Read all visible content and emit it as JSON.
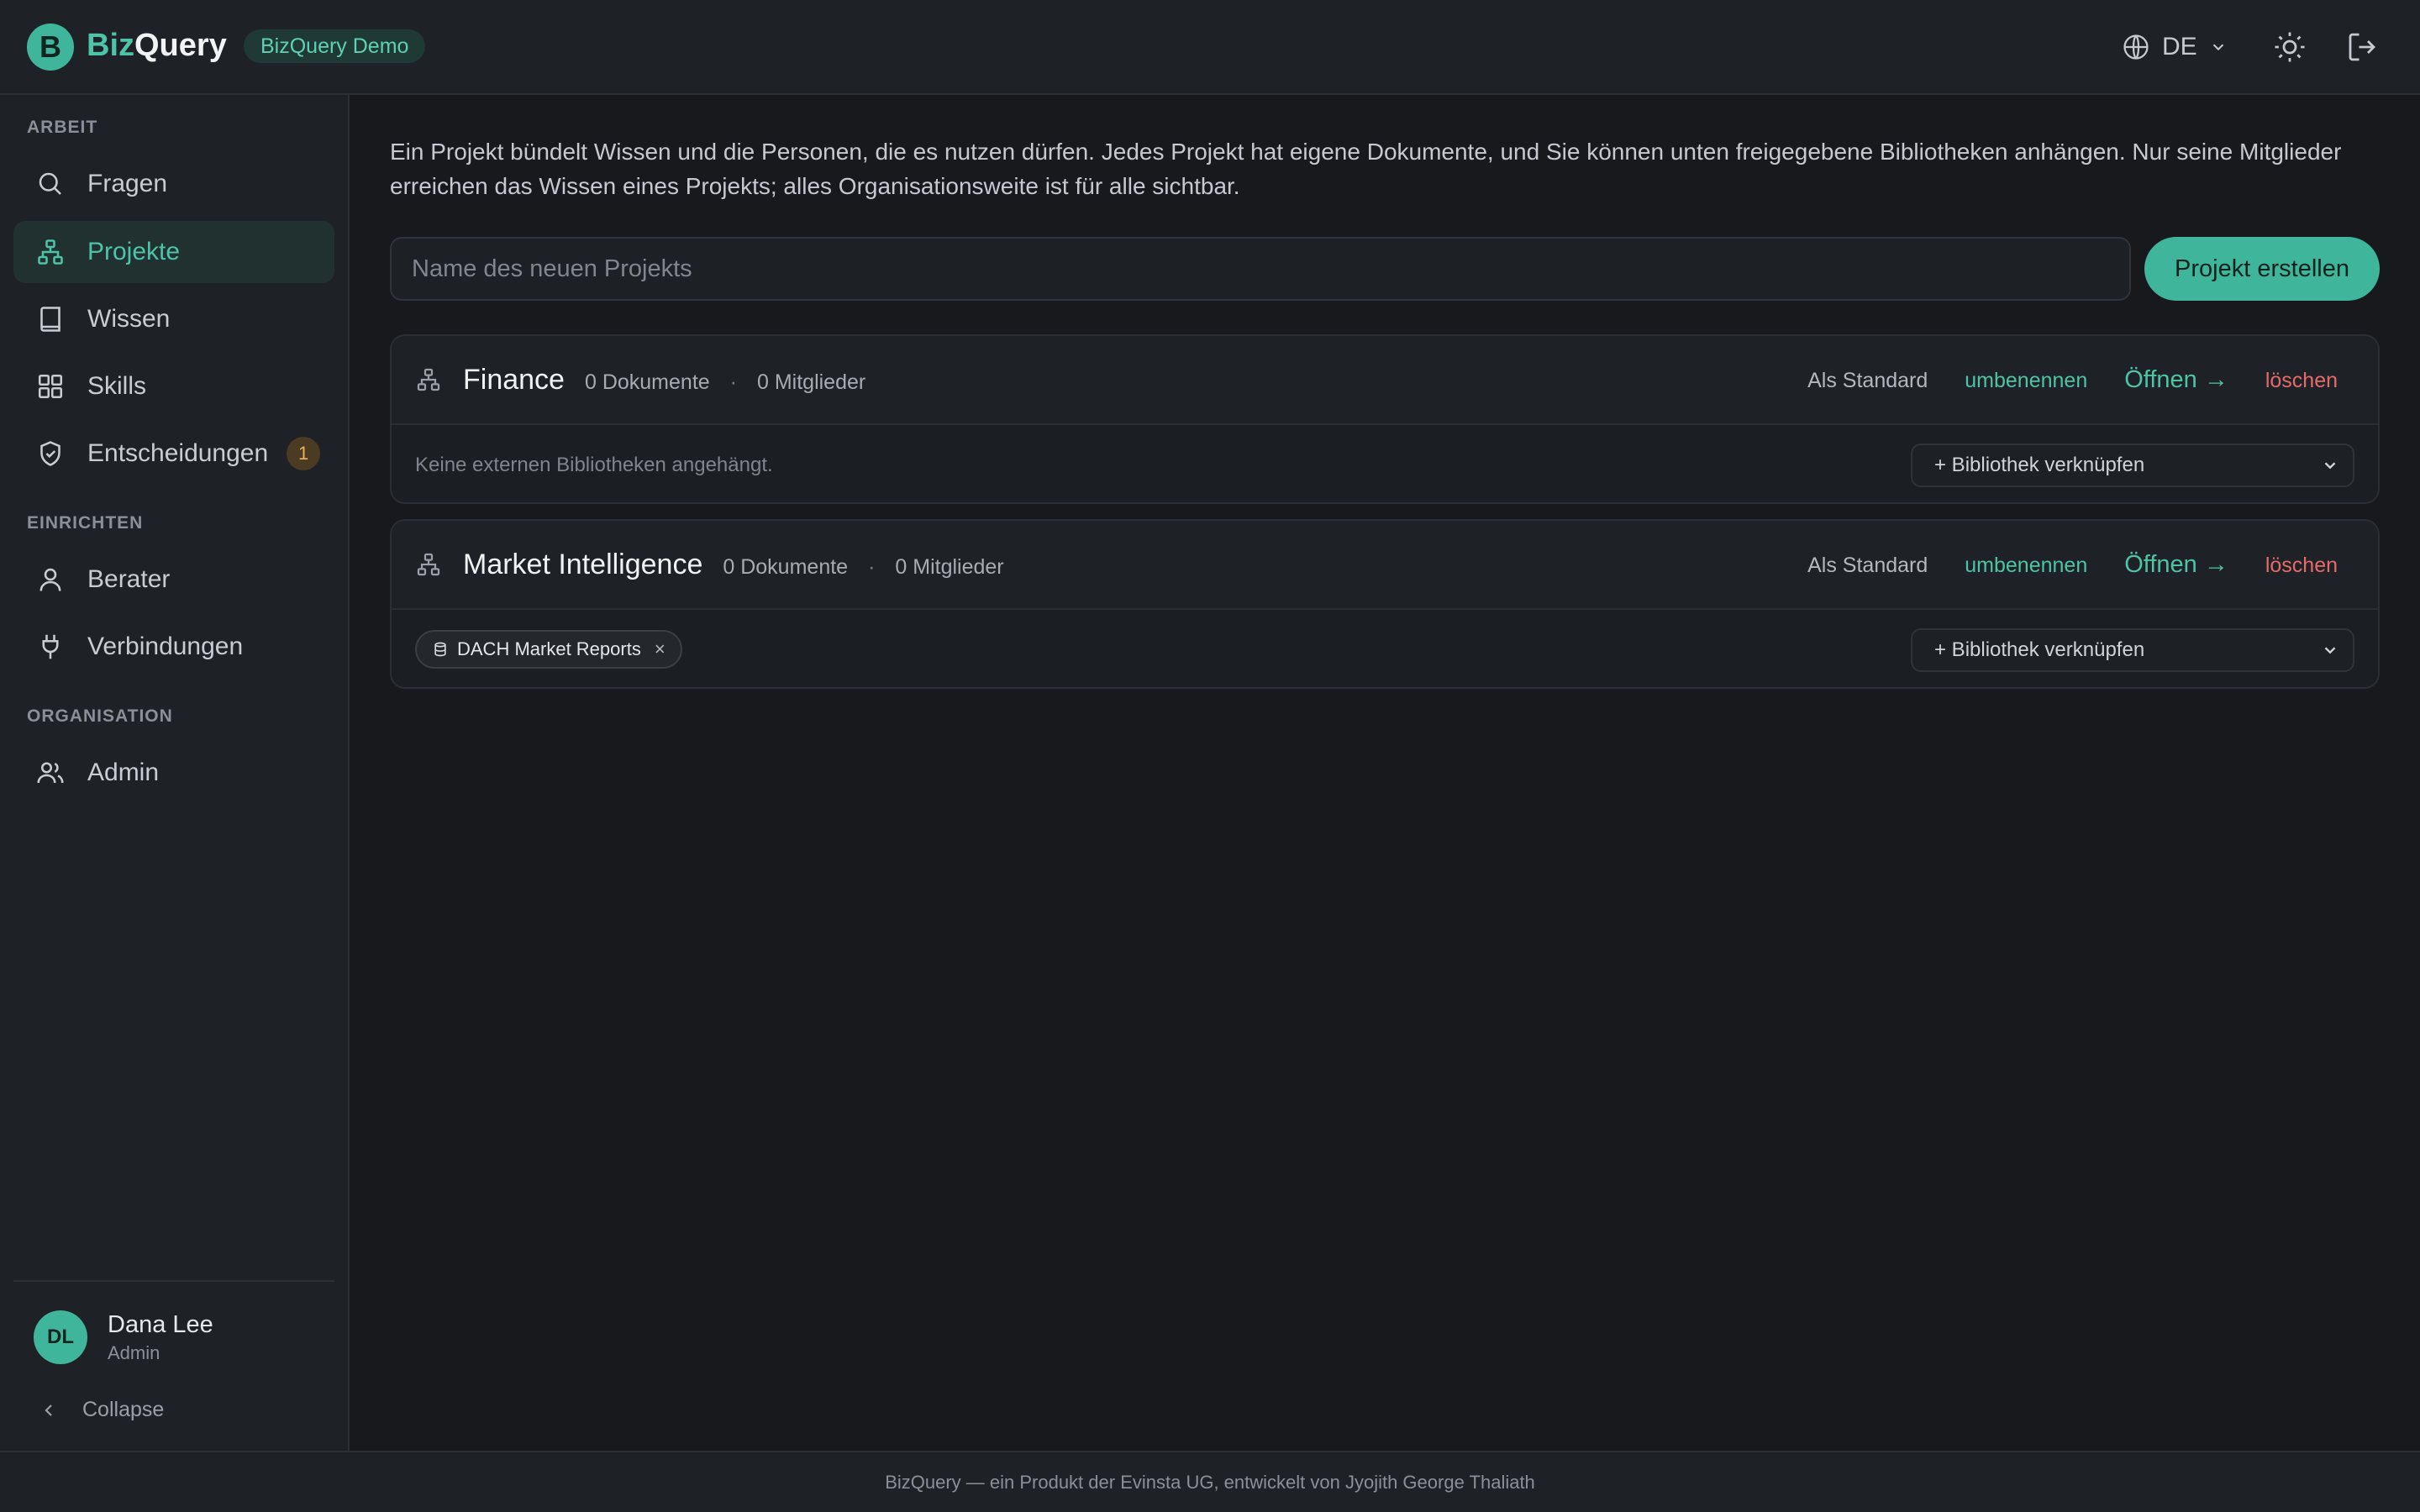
{
  "header": {
    "logo_letter": "B",
    "brand_part1": "Biz",
    "brand_part2": "Query",
    "tenant_tag": "BizQuery Demo",
    "language": "DE",
    "icons": [
      "globe-icon",
      "chevron-down-icon",
      "sun-icon",
      "logout-icon"
    ]
  },
  "sidebar": {
    "sections": [
      {
        "label": "ARBEIT",
        "items": [
          {
            "label": "Fragen",
            "icon": "search-icon"
          },
          {
            "label": "Projekte",
            "icon": "hierarchy-icon",
            "active": true
          },
          {
            "label": "Wissen",
            "icon": "book-icon"
          },
          {
            "label": "Skills",
            "icon": "grid-icon"
          },
          {
            "label": "Entscheidungen",
            "icon": "shield-check-icon",
            "badge": "1"
          }
        ]
      },
      {
        "label": "EINRICHTEN",
        "items": [
          {
            "label": "Berater",
            "icon": "user-icon"
          },
          {
            "label": "Verbindungen",
            "icon": "plug-icon"
          }
        ]
      },
      {
        "label": "ORGANISATION",
        "items": [
          {
            "label": "Admin",
            "icon": "users-icon"
          }
        ]
      }
    ],
    "user": {
      "initials": "DL",
      "name": "Dana Lee",
      "role": "Admin"
    },
    "collapse_label": "Collapse"
  },
  "main": {
    "intro": "Ein Projekt bündelt Wissen und die Personen, die es nutzen dürfen. Jedes Projekt hat eigene Dokumente, und Sie können unten freigegebene Bibliotheken anhängen. Nur seine Mitglieder erreichen das Wissen eines Projekts; alles Organisationsweite ist für alle sichtbar.",
    "new_project": {
      "placeholder": "Name des neuen Projekts",
      "value": "",
      "button": "Projekt erstellen"
    },
    "actions": {
      "set_default": "Als Standard",
      "rename": "umbenennen",
      "open": "Öffnen →",
      "delete": "löschen",
      "link_library": "+ Bibliothek verknüpfen",
      "meta_separator": "·"
    },
    "projects": [
      {
        "name": "Finance",
        "documents": "0 Dokumente",
        "members": "0 Mitglieder",
        "empty_libraries": "Keine externen Bibliotheken angehängt.",
        "libraries": []
      },
      {
        "name": "Market Intelligence",
        "documents": "0 Dokumente",
        "members": "0 Mitglieder",
        "libraries": [
          {
            "name": "DACH Market Reports",
            "remove": "×"
          }
        ]
      }
    ]
  },
  "footer": {
    "text": "BizQuery — ein Produkt der Evinsta UG, entwickelt von Jyojith George Thaliath"
  },
  "colors": {
    "accent": "#3fb69c",
    "danger": "#e56b6b",
    "background": "#17191d",
    "panel": "#1e2126"
  }
}
